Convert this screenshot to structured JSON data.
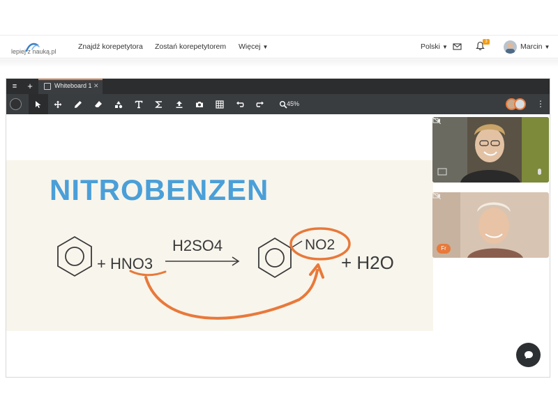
{
  "brand": {
    "logo_text": "lepiej z nauką.pl"
  },
  "nav": {
    "links": [
      "Znajdź korepetytora",
      "Zostań korepetytorem",
      "Więcej"
    ],
    "language": "Polski",
    "notification_count": "3",
    "user_name": "Marcin"
  },
  "whiteboard": {
    "tab_title": "Whiteboard 1",
    "zoom": "45%"
  },
  "board": {
    "heading": "NITROBENZEN",
    "reactant_acid": "+ HNO3",
    "catalyst": "H2SO4",
    "substituent": "NO2",
    "byproduct": "+ H2O"
  },
  "participants": [
    {
      "initials": ""
    },
    {
      "initials": "Fr"
    }
  ],
  "colors": {
    "accent": "#e8793a",
    "chalk_blue": "#4a9fd8",
    "ink": "#3a3a3a",
    "toolbar": "#3a3d40"
  }
}
